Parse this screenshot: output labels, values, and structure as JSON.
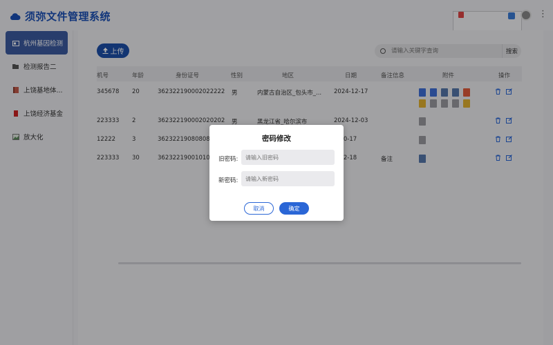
{
  "app": {
    "title": "须弥文件管理系统"
  },
  "sidebar": {
    "items": [
      {
        "label": "杭州基因检测",
        "icon": "folder-image-icon",
        "active": true
      },
      {
        "label": "检测报告二",
        "icon": "folder-open-icon",
        "active": false
      },
      {
        "label": "上饶基地体...",
        "icon": "book-icon",
        "active": false
      },
      {
        "label": "上饶经济基金",
        "icon": "notebook-icon",
        "active": false
      },
      {
        "label": "放大化",
        "icon": "image-icon",
        "active": false
      }
    ]
  },
  "toolbar": {
    "upload_label": "上传"
  },
  "search": {
    "placeholder": "请输入关键字查询",
    "button_label": "搜索"
  },
  "table": {
    "columns": [
      "机号",
      "年龄",
      "身份证号",
      "性别",
      "地区",
      "日期",
      "备注信息",
      "附件",
      "操作"
    ],
    "rows": [
      {
        "phone": "345678",
        "age": "20",
        "id": "362322190002022222",
        "gender": "男",
        "region": "内蒙古自治区_包头市_...",
        "date": "2024-12-17",
        "note": ""
      },
      {
        "phone": "223333",
        "age": "2",
        "id": "362322190002020202",
        "gender": "男",
        "region": "黑龙江省_哈尔滨市",
        "date": "2024-12-03",
        "note": ""
      },
      {
        "phone": "12222",
        "age": "3",
        "id": "362322190808080808",
        "gender": "",
        "region": "",
        "date": "4-10-17",
        "note": ""
      },
      {
        "phone": "223333",
        "age": "30",
        "id": "362322190010101010",
        "gender": "",
        "region": "",
        "date": "4-12-18",
        "note": "备注"
      }
    ]
  },
  "dialog": {
    "title": "密码修改",
    "old_label": "旧密码:",
    "old_placeholder": "请输入旧密码",
    "new_label": "新密码:",
    "new_placeholder": "请输入新密码",
    "cancel_label": "取消",
    "ok_label": "确定"
  },
  "colors": {
    "accent": "#2a66d6",
    "brand": "#1a4fb5",
    "sidebar_active": "#3b5aa0"
  }
}
